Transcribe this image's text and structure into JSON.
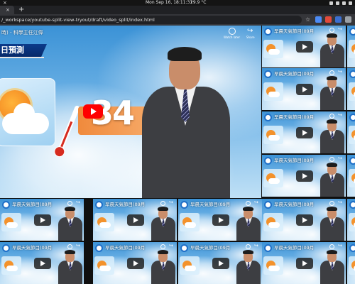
{
  "os_bar": {
    "close_glyph": "×",
    "datetime": "Mon Sep 16, 18:11:31",
    "weather": "29.9 °C"
  },
  "browser": {
    "tab_close_glyph": "×",
    "new_tab_glyph": "+",
    "url": "/_workspace/youtube-split-view-tryout/draft/video_split/index.html"
  },
  "main_video": {
    "title": "時) - 科學主任江偉",
    "banner": "日預測",
    "temperature": "34",
    "watch_later_label": "Watch later",
    "share_label": "Share",
    "share_glyph": "↪"
  },
  "thumbnail": {
    "title": "早晨天氣節目(09月",
    "share_glyph": "↪"
  },
  "colors": {
    "accent_red": "#ff0000",
    "banner_blue": "#0c3b8a",
    "temp_orange": "#f08a3c"
  }
}
